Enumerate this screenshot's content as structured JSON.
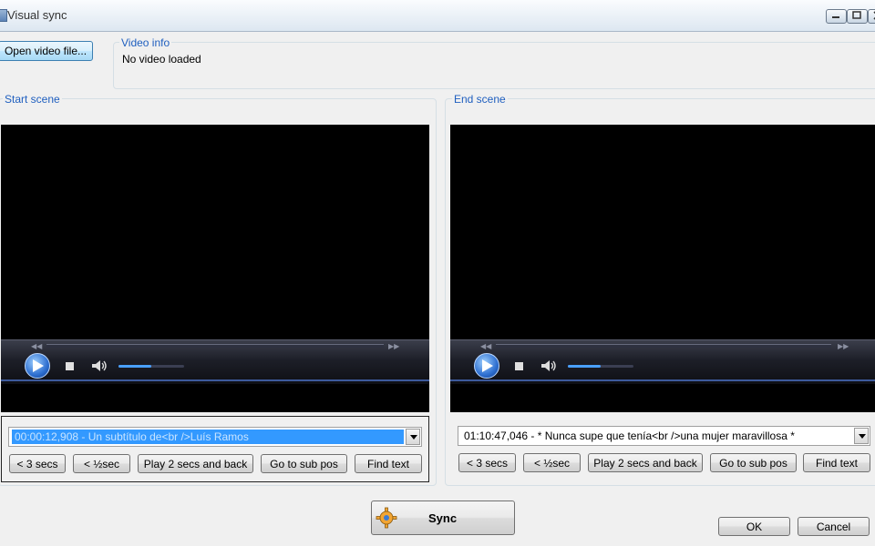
{
  "window": {
    "title": "Visual sync"
  },
  "toolbar": {
    "open_video_label": "Open video file..."
  },
  "video_info": {
    "legend": "Video info",
    "status": "No video loaded"
  },
  "start_scene": {
    "legend": "Start scene",
    "subtitle": "00:00:12,908 - Un subtítulo de<br />Luís Ramos",
    "volume_level": 0.5,
    "buttons": {
      "back3": "< 3 secs",
      "back_half": "< ½sec",
      "play2": "Play 2 secs and back",
      "goto": "Go to sub pos",
      "find": "Find text"
    }
  },
  "end_scene": {
    "legend": "End scene",
    "subtitle": "01:10:47,046 - * Nunca supe que tenía<br />una mujer maravillosa *",
    "volume_level": 0.5,
    "buttons": {
      "back3": "< 3 secs",
      "back_half": "< ½sec",
      "play2": "Play 2 secs and back",
      "goto": "Go to sub pos",
      "find": "Find text"
    }
  },
  "actions": {
    "sync_label": "Sync",
    "ok_label": "OK",
    "cancel_label": "Cancel"
  },
  "icons": {
    "window": "app-icon",
    "minimize": "minimize-icon",
    "maximize": "maximize-icon",
    "close": "close-icon",
    "play": "play-icon",
    "stop": "stop-icon",
    "volume": "volume-icon",
    "dropdown": "chevron-down-icon",
    "sync": "gear-sync-icon"
  },
  "colors": {
    "accent": "#1f5fbf",
    "selection": "#3399ff",
    "video_bg": "#000000"
  }
}
